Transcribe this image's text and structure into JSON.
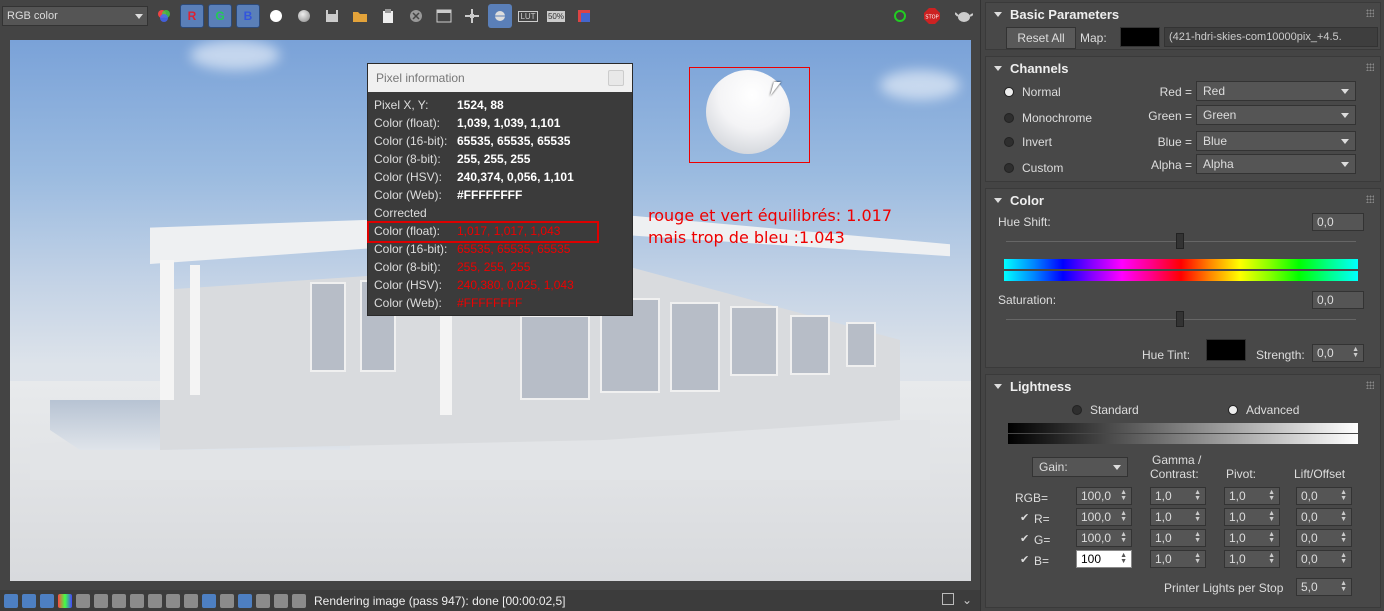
{
  "toolbar": {
    "channel_select": "RGB color",
    "r_label": "R",
    "g_label": "G",
    "b_label": "B",
    "icons": [
      "color-channels-icon",
      "r-channel",
      "g-channel",
      "b-channel",
      "white-circle",
      "grey-sphere",
      "save-icon",
      "open-icon",
      "clipboard-icon",
      "clear-icon",
      "window-icon",
      "crosshair-icon",
      "render-region-icon",
      "lut-icon",
      "50-percent-icon",
      "frame-icon",
      "refresh-icon",
      "stop-icon",
      "teapot-icon"
    ],
    "lut_label": "LUT",
    "half_label": "50%",
    "stop_label": "STOP"
  },
  "pixel_info": {
    "title": "Pixel information",
    "rows": [
      {
        "label": "Pixel X, Y:",
        "value": "1524, 88"
      },
      {
        "label": "Color (float):",
        "value": "1,039, 1,039, 1,101"
      },
      {
        "label": "Color (16-bit):",
        "value": "65535, 65535, 65535"
      },
      {
        "label": "Color (8-bit):",
        "value": "255, 255, 255"
      },
      {
        "label": "Color (HSV):",
        "value": "240,374, 0,056, 1,101"
      },
      {
        "label": "Color (Web):",
        "value": "#FFFFFFFF"
      }
    ],
    "corrected_label": "Corrected",
    "corrected_rows": [
      {
        "label": "Color (float):",
        "value": "1,017, 1,017, 1,043"
      },
      {
        "label": "Color (16-bit):",
        "value": "65535, 65535, 65535"
      },
      {
        "label": "Color (8-bit):",
        "value": "255, 255, 255"
      },
      {
        "label": "Color (HSV):",
        "value": "240,380, 0,025, 1,043"
      },
      {
        "label": "Color (Web):",
        "value": "#FFFFFFFF"
      }
    ]
  },
  "annotation": {
    "line1": "rouge et vert équilibrés: 1.017",
    "line2": "mais trop de bleu :1.043"
  },
  "status": {
    "text": "Rendering image (pass 947): done [00:00:02,5]"
  },
  "panel": {
    "basic": {
      "title": "Basic Parameters",
      "reset_label": "Reset All",
      "map_label": "Map:",
      "map_value": "(421-hdri-skies-com10000pix_+4.5."
    },
    "channels": {
      "title": "Channels",
      "modes": [
        "Normal",
        "Monochrome",
        "Invert",
        "Custom"
      ],
      "selected": "Normal",
      "mappings": [
        {
          "label": "Red =",
          "value": "Red"
        },
        {
          "label": "Green =",
          "value": "Green"
        },
        {
          "label": "Blue =",
          "value": "Blue"
        },
        {
          "label": "Alpha =",
          "value": "Alpha"
        }
      ]
    },
    "color": {
      "title": "Color",
      "hue_shift_label": "Hue Shift:",
      "hue_shift_value": "0,0",
      "saturation_label": "Saturation:",
      "saturation_value": "0,0",
      "hue_tint_label": "Hue Tint:",
      "strength_label": "Strength:",
      "strength_value": "0,0"
    },
    "lightness": {
      "title": "Lightness",
      "mode_standard": "Standard",
      "mode_advanced": "Advanced",
      "selected": "Advanced",
      "gain_select": "Gain:",
      "col_gamma": "Gamma /",
      "col_contrast": "Contrast:",
      "col_pivot": "Pivot:",
      "col_lift": "Lift/Offset",
      "rows": [
        {
          "label": "RGB=",
          "check": false,
          "gain": "100,0",
          "gamma": "1,0",
          "pivot": "1,0",
          "lift": "0,0"
        },
        {
          "label": "R=",
          "check": true,
          "gain": "100,0",
          "gamma": "1,0",
          "pivot": "1,0",
          "lift": "0,0"
        },
        {
          "label": "G=",
          "check": true,
          "gain": "100,0",
          "gamma": "1,0",
          "pivot": "1,0",
          "lift": "0,0"
        },
        {
          "label": "B=",
          "check": true,
          "gain": "100",
          "gamma": "1,0",
          "pivot": "1,0",
          "lift": "0,0"
        }
      ],
      "printer_lights_label": "Printer Lights per Stop",
      "printer_lights_value": "5,0"
    }
  }
}
